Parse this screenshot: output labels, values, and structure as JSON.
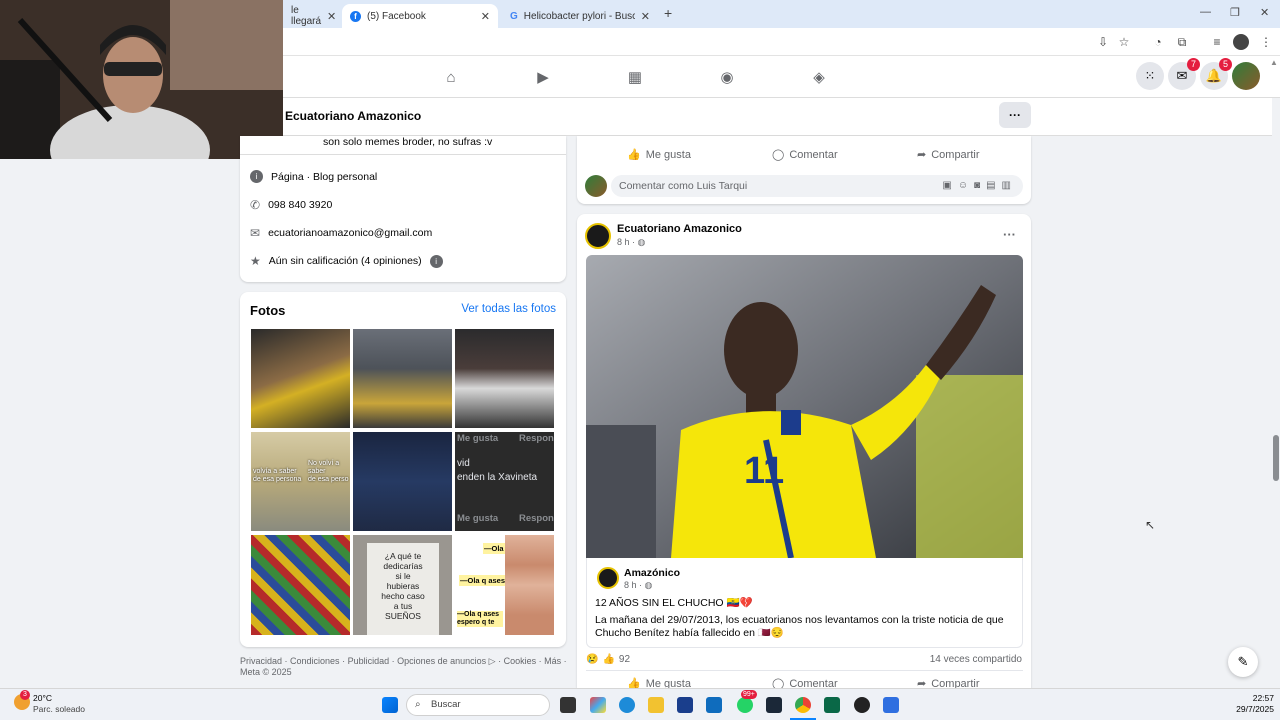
{
  "browser": {
    "tabs": [
      {
        "label": "le llegará"
      },
      {
        "label": "(5) Facebook"
      },
      {
        "label": "Helicobacter pylori - Buscar co"
      }
    ],
    "new_tab": "+"
  },
  "fb_nav": {
    "messenger_badge": "7",
    "notifications_badge": "5"
  },
  "page_header": {
    "title": "Ecuatoriano Amazonico",
    "more": "···"
  },
  "intro": {
    "bio": "son solo memes broder, no sufras :v",
    "category_label": "Página",
    "category_value": " · Blog personal",
    "phone": "098 840 3920",
    "email": "ecuatorianoamazonico@gmail.com",
    "rating": "Aún sin calificación (4 opiniones)"
  },
  "photos": {
    "title": "Fotos",
    "see_all": "Ver todas las fotos",
    "overlay_texts": [
      "Me gusta",
      "Respon",
      "vid",
      "enden la Xavineta",
      "Me gusta",
      "Respon"
    ],
    "meme_text": [
      "¿A qué te",
      "dedicarías",
      "si le",
      "hubieras",
      "hecho caso",
      "a tus",
      "SUEÑOS"
    ],
    "ola_texts": [
      "—Ola",
      "—Ola q ases",
      "—Ola q ases espero q te"
    ],
    "bus_text": [
      "volvía a saber",
      "de esa persona",
      "No volví a saber",
      "de esa perso"
    ]
  },
  "footer": {
    "links": [
      "Privacidad",
      "Condiciones",
      "Publicidad",
      "Opciones de anuncios",
      "Cookies",
      "Más"
    ],
    "meta": "Meta © 2025"
  },
  "prev_post": {
    "like": "Me gusta",
    "comment": "Comentar",
    "share": "Compartir",
    "comment_placeholder": "Comentar como Luis Tarqui"
  },
  "post": {
    "author": "Ecuatoriano Amazonico",
    "time": "8 h",
    "more": "···",
    "shared_author": "Amazónico",
    "shared_time": "8 h",
    "headline": "12 AÑOS SIN EL CHUCHO 🇪🇨💔",
    "body": "La mañana del 29/07/2013, los ecuatorianos nos levantamos con la triste noticia de que Chucho Benítez había fallecido en 🇶🇦😔",
    "jersey_number": "11",
    "reactions": "92",
    "shares": "14 veces compartido",
    "like": "Me gusta",
    "comment": "Comentar",
    "share": "Compartir"
  },
  "taskbar": {
    "weather_temp": "20°C",
    "weather_desc": "Parc. soleado",
    "weather_badge": "3",
    "search": "Buscar",
    "time": "22:57",
    "date": "29/7/2025",
    "chat_badge": "99+"
  },
  "colors": {
    "fb_blue": "#1877f2",
    "jersey_yellow": "#f5e60a",
    "badge_red": "#e41e3f"
  }
}
